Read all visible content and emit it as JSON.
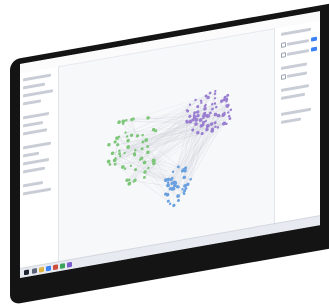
{
  "window": {
    "title": ""
  },
  "graph": {
    "clusters": [
      {
        "name": "",
        "color": "#7dc67a",
        "nodes": 60
      },
      {
        "name": "",
        "color": "#9a7fd1",
        "nodes": 80
      },
      {
        "name": "",
        "color": "#6aa0e0",
        "nodes": 40
      }
    ],
    "edge_color": "#cfd3da"
  },
  "taskbar": {
    "time": ""
  },
  "accent": "#3b82f6"
}
